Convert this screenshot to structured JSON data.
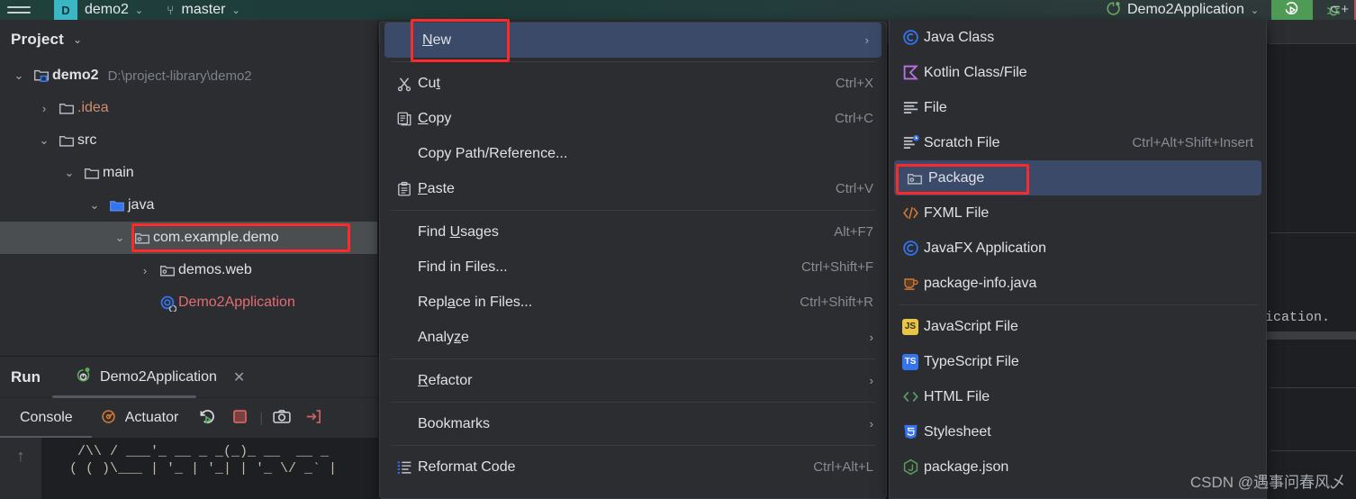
{
  "topbar": {
    "menu_icon": "hamburger-icon",
    "project_badge": "D",
    "project_name": "demo2",
    "branch_icon": "git-branch-icon",
    "branch_name": "master",
    "run_config_icon": "spring-boot-icon",
    "run_config_name": "Demo2Application",
    "run_icon": "run-icon",
    "debug_icon": "debug-icon",
    "stop_icon": "stop-icon",
    "more_icon": "kebab-icon",
    "right_icon": "new-ui-feedback-icon"
  },
  "project": {
    "title": "Project",
    "chevron": "chevron-down-icon",
    "tree": [
      {
        "indent": 0,
        "arrow": "down",
        "icon": "module-folder-icon",
        "label": "demo2",
        "bold": true,
        "path": "D:\\project-library\\demo2",
        "selected": false
      },
      {
        "indent": 1,
        "arrow": "right",
        "icon": "folder-icon",
        "label": ".idea",
        "color": "orange",
        "selected": false
      },
      {
        "indent": 1,
        "arrow": "down",
        "icon": "folder-icon",
        "label": "src",
        "selected": false
      },
      {
        "indent": 2,
        "arrow": "down",
        "icon": "folder-icon",
        "label": "main",
        "selected": false
      },
      {
        "indent": 3,
        "arrow": "down",
        "icon": "source-folder-icon",
        "label": "java",
        "selected": false
      },
      {
        "indent": 4,
        "arrow": "down",
        "icon": "package-icon",
        "label": "com.example.demo",
        "selected": true,
        "highlighted": true
      },
      {
        "indent": 5,
        "arrow": "right",
        "icon": "package-icon",
        "label": "demos.web",
        "selected": false
      },
      {
        "indent": 5,
        "arrow": "none",
        "icon": "spring-class-icon",
        "label": "Demo2Application",
        "color": "redish",
        "selected": false
      }
    ]
  },
  "editor": {
    "code_fragment": "lication."
  },
  "run_panel": {
    "title": "Run",
    "tab_icon": "spring-run-icon",
    "tab_name": "Demo2Application",
    "tab_close": "close-icon",
    "console_tab": "Console",
    "actuator_icon": "actuator-icon",
    "actuator_tab": "Actuator",
    "rerun_icon": "rerun-icon",
    "stop_icon": "stop-icon",
    "camera_icon": "camera-icon",
    "export_icon": "export-icon",
    "scroll_icon": "scroll-up-icon",
    "console_line1": "  /\\\\ / ___'_ __ _ _(_)_ __  __ _",
    "console_line2": " ( ( )\\___ | '_ | '_| | '_ \\/ _` |"
  },
  "context_menu": {
    "items": [
      {
        "kind": "item",
        "icon": "",
        "label": "New",
        "mnemonic": "N",
        "arrow": true,
        "highlighted": true,
        "annotated": true
      },
      {
        "kind": "sep"
      },
      {
        "kind": "item",
        "icon": "cut-icon",
        "label": "Cut",
        "mnemonic": "t",
        "shortcut": "Ctrl+X"
      },
      {
        "kind": "item",
        "icon": "copy-icon",
        "label": "Copy",
        "mnemonic": "C",
        "shortcut": "Ctrl+C"
      },
      {
        "kind": "item",
        "icon": "",
        "label": "Copy Path/Reference..."
      },
      {
        "kind": "item",
        "icon": "paste-icon",
        "label": "Paste",
        "mnemonic": "P",
        "shortcut": "Ctrl+V"
      },
      {
        "kind": "sep"
      },
      {
        "kind": "item",
        "icon": "",
        "label": "Find Usages",
        "mnemonic": "U",
        "shortcut": "Alt+F7"
      },
      {
        "kind": "item",
        "icon": "",
        "label": "Find in Files...",
        "shortcut": "Ctrl+Shift+F"
      },
      {
        "kind": "item",
        "icon": "",
        "label": "Replace in Files...",
        "mnemonic": "a",
        "shortcut": "Ctrl+Shift+R"
      },
      {
        "kind": "item",
        "icon": "",
        "label": "Analyze",
        "mnemonic": "z",
        "arrow": true
      },
      {
        "kind": "sep"
      },
      {
        "kind": "item",
        "icon": "",
        "label": "Refactor",
        "mnemonic": "R",
        "arrow": true
      },
      {
        "kind": "sep"
      },
      {
        "kind": "item",
        "icon": "",
        "label": "Bookmarks",
        "arrow": true
      },
      {
        "kind": "sep"
      },
      {
        "kind": "item",
        "icon": "reformat-icon",
        "label": "Reformat Code",
        "shortcut": "Ctrl+Alt+L"
      }
    ]
  },
  "sub_menu": {
    "items": [
      {
        "kind": "item",
        "icon": "java-class-icon",
        "label": "Java Class"
      },
      {
        "kind": "item",
        "icon": "kotlin-class-icon",
        "label": "Kotlin Class/File"
      },
      {
        "kind": "item",
        "icon": "file-icon",
        "label": "File"
      },
      {
        "kind": "item",
        "icon": "scratch-file-icon",
        "label": "Scratch File",
        "shortcut": "Ctrl+Alt+Shift+Insert"
      },
      {
        "kind": "item",
        "icon": "package-icon",
        "label": "Package",
        "highlighted": true,
        "annotated": true
      },
      {
        "kind": "item",
        "icon": "fxml-file-icon",
        "label": "FXML File"
      },
      {
        "kind": "item",
        "icon": "java-class-icon",
        "label": "JavaFX Application"
      },
      {
        "kind": "item",
        "icon": "java-coffee-icon",
        "label": "package-info.java"
      },
      {
        "kind": "sep"
      },
      {
        "kind": "item",
        "icon": "javascript-icon",
        "label": "JavaScript File"
      },
      {
        "kind": "item",
        "icon": "typescript-icon",
        "label": "TypeScript File"
      },
      {
        "kind": "item",
        "icon": "html-file-icon",
        "label": "HTML File"
      },
      {
        "kind": "item",
        "icon": "stylesheet-icon",
        "label": "Stylesheet"
      },
      {
        "kind": "item",
        "icon": "nodejs-icon",
        "label": "package.json"
      }
    ]
  },
  "watermark": "CSDN @遇事问春风乄",
  "colors": {
    "accent_selection": "#3b4a68",
    "annotation_red": "#ff2a2a",
    "panel_bg": "#2b2d30",
    "editor_bg": "#1e1f22",
    "topbar_green": "#20403c"
  }
}
